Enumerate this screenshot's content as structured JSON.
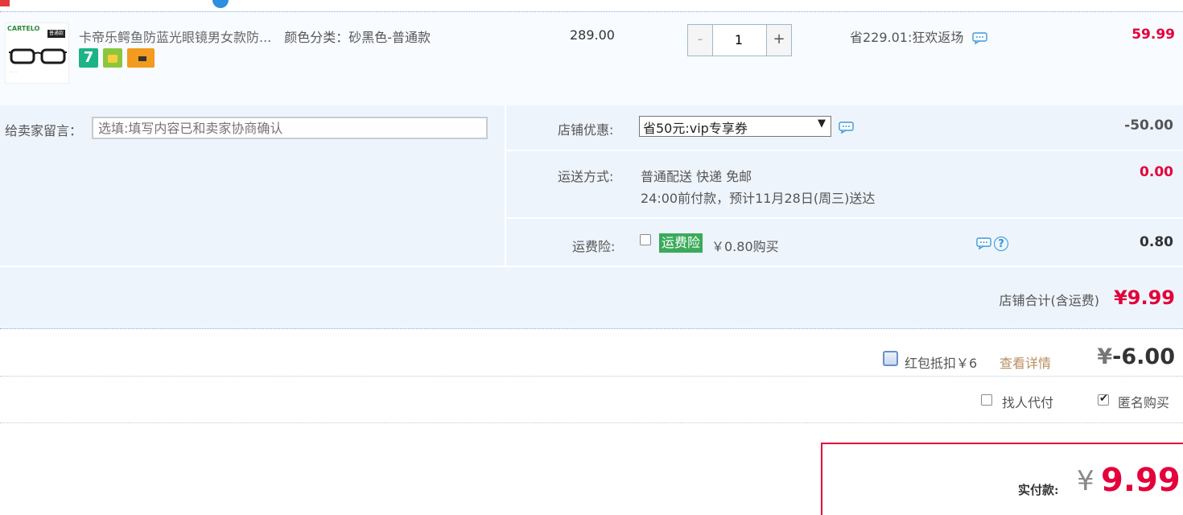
{
  "item": {
    "title": "卡帝乐鳄鱼防蓝光眼镜男女款防...",
    "sku": "颜色分类：砂黑色-普通款",
    "thumb_brand": "CARTELO",
    "thumb_tag": "普通款",
    "service_icons": [
      "seven-day-return-icon",
      "shopping-bag-icon",
      "credit-card-icon"
    ],
    "unit_price": "289.00",
    "quantity": "1",
    "minus_label": "-",
    "plus_label": "+",
    "discount": "省229.01:狂欢返场",
    "subtotal": "59.99"
  },
  "message": {
    "label": "给卖家留言：",
    "placeholder": "选填:填写内容已和卖家协商确认"
  },
  "shop_coupon": {
    "label": "店铺优惠:",
    "selected": "省50元:vip专享券",
    "value": "-50.00"
  },
  "shipping": {
    "label": "运送方式:",
    "method": "普通配送 快递 免邮",
    "eta": "24:00前付款，预计11月28日(周三)送达",
    "value": "0.00"
  },
  "insurance": {
    "label": "运费险:",
    "badge": "运费险",
    "price": "￥0.80购买",
    "value": "0.80",
    "help": "?"
  },
  "shop_total": {
    "label": "店铺合计(含运费)",
    "value": "¥9.99"
  },
  "red_packet": {
    "label": "红包抵扣￥6",
    "details_link": "查看详情",
    "yen": "¥",
    "value": "-6.00"
  },
  "options": {
    "friend_pay": "找人代付",
    "anonymous": "匿名购买"
  },
  "payment": {
    "label": "实付款:",
    "yen": "¥",
    "value": "9.99"
  },
  "colors": {
    "accent_red": "#e4003a",
    "panel_bg": "#eef4fc",
    "insurance_green": "#3aaa5b"
  }
}
